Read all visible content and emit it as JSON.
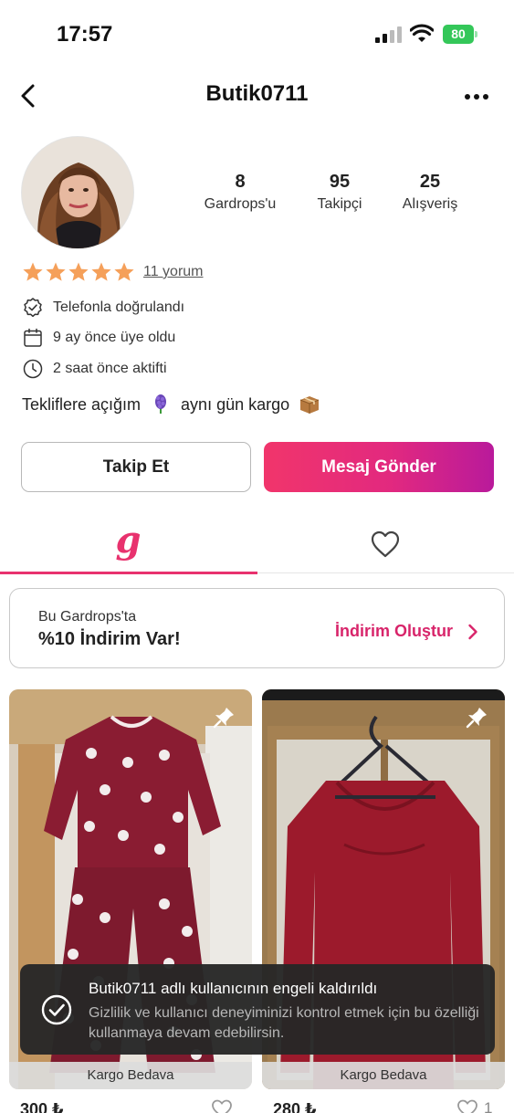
{
  "status_bar": {
    "time": "17:57",
    "battery": "80"
  },
  "header": {
    "title": "Butik0711",
    "back_icon": "chevron-left-icon",
    "more_icon": "more-horizontal-icon"
  },
  "profile": {
    "stats": [
      {
        "value": "8",
        "label": "Gardrops'u"
      },
      {
        "value": "95",
        "label": "Takipçi"
      },
      {
        "value": "25",
        "label": "Alışveriş"
      }
    ],
    "rating_stars": 5,
    "review_link": "11 yorum",
    "info": [
      {
        "icon": "verified-badge-icon",
        "text": "Telefonla doğrulandı"
      },
      {
        "icon": "calendar-icon",
        "text": "9 ay önce üye oldu"
      },
      {
        "icon": "clock-icon",
        "text": "2 saat önce aktifti"
      }
    ],
    "bio": {
      "part1": "Tekliflere açığım",
      "part2": "aynı gün kargo",
      "emoji1": "hyacinth-emoji",
      "emoji2": "package-emoji"
    }
  },
  "actions": {
    "follow": "Takip Et",
    "message": "Mesaj Gönder"
  },
  "tabs": {
    "wardrobe_glyph": "g",
    "likes_icon": "heart-outline-icon",
    "active": "wardrobe"
  },
  "discount": {
    "subtitle": "Bu Gardrops'ta",
    "title": "%10 İndirim Var!",
    "action": "İndirim Oluştur"
  },
  "products": [
    {
      "shipping": "Kargo Bedava",
      "price": "300 ₺",
      "likes": ""
    },
    {
      "shipping": "Kargo Bedava",
      "price": "280 ₺",
      "likes": "1"
    }
  ],
  "toast": {
    "title": "Butik0711 adlı kullanıcının engeli kaldırıldı",
    "body": "Gizlilik ve kullanıcı deneyiminizi kontrol etmek için bu özelliği kullanmaya devam edebilirsin."
  },
  "colors": {
    "accent": "#e8326e",
    "star": "#f5a05a",
    "toast_bg": "#262626",
    "battery": "#34c759"
  }
}
